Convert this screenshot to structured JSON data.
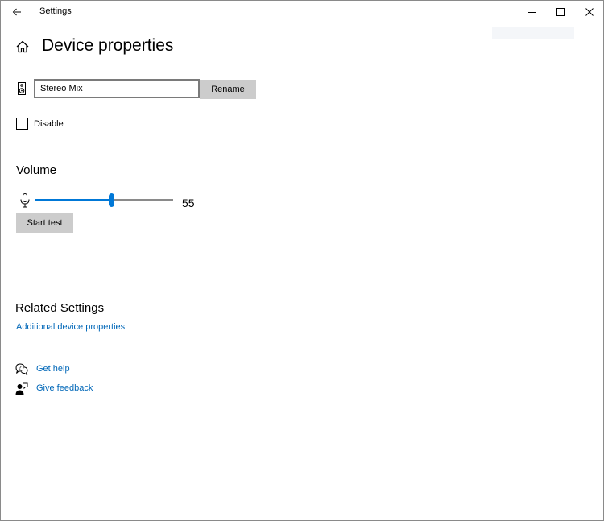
{
  "window": {
    "title": "Settings"
  },
  "header": {
    "title": "Device properties"
  },
  "device": {
    "name_value": "Stereo Mix",
    "rename_label": "Rename",
    "disable_label": "Disable",
    "disable_checked": false
  },
  "volume": {
    "title": "Volume",
    "value": 55,
    "value_text": "55",
    "max": 100,
    "start_test_label": "Start test"
  },
  "related": {
    "title": "Related Settings",
    "additional_link": "Additional device properties"
  },
  "help": {
    "get_help": "Get help",
    "give_feedback": "Give feedback"
  },
  "colors": {
    "accent": "#0078d7",
    "link": "#0067b8",
    "button_bg": "#cccccc"
  },
  "icons": {
    "back": "arrow-left-icon",
    "home": "home-icon",
    "device": "speaker-icon",
    "volume": "microphone-icon",
    "help": "chat-bubbles-icon",
    "feedback": "person-feedback-icon"
  }
}
